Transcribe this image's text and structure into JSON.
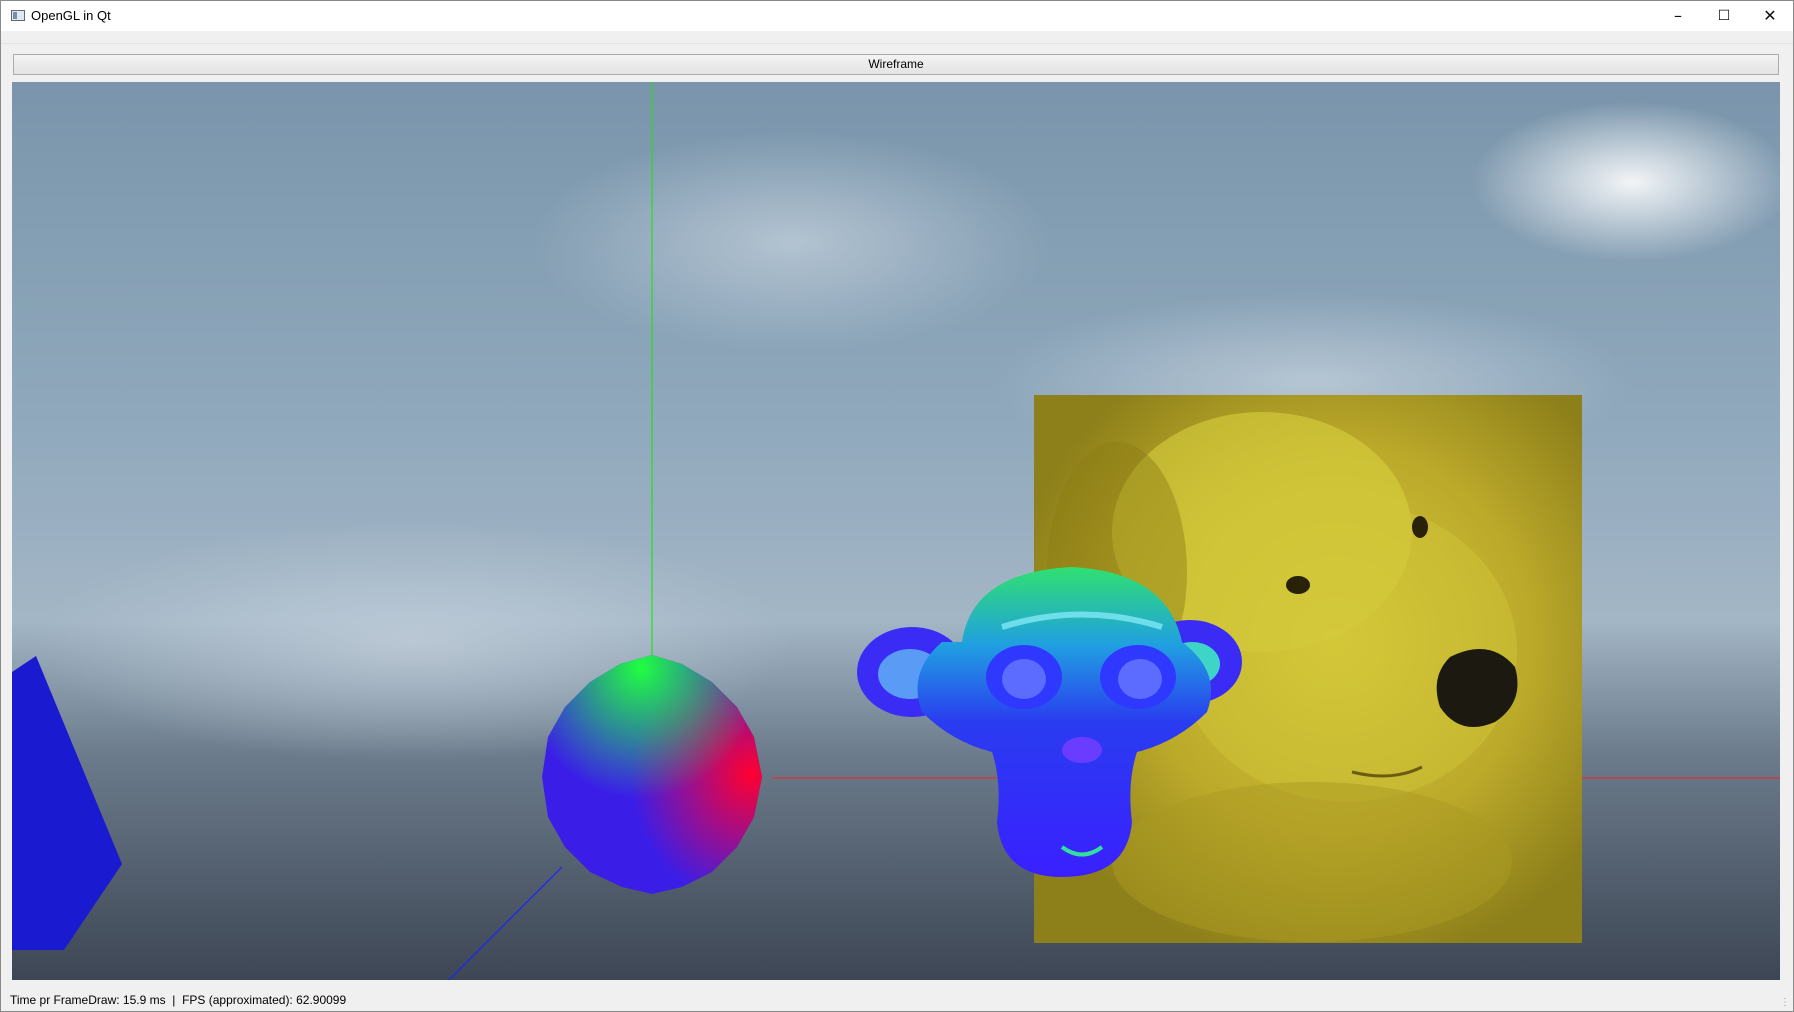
{
  "window": {
    "title": "OpenGL in Qt",
    "minimize_icon": "minimize-icon",
    "maximize_icon": "maximize-icon",
    "close_icon": "close-icon"
  },
  "toolbar": {
    "wireframe_label": "Wireframe"
  },
  "scene": {
    "sky_color": "#6f8aa0",
    "axis_x_color": "#ff2020",
    "axis_y_color": "#20e020",
    "axis_z_color": "#2020ff",
    "objects": [
      "blue-pyramid",
      "normal-shaded-sphere",
      "suzanne-monkey-head",
      "dog-photo-texture-quad"
    ]
  },
  "status": {
    "time_label": "Time pr FrameDraw: 15.9 ms",
    "separator": "|",
    "fps_label": "FPS (approximated): 62.90099"
  }
}
